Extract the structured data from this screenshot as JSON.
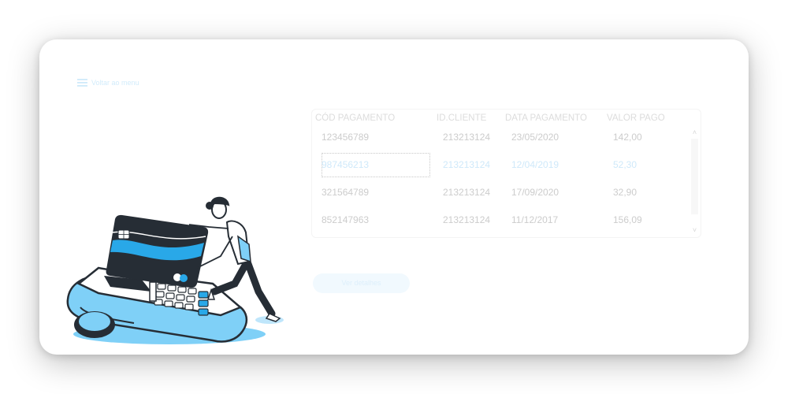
{
  "menu": {
    "label": "Voltar ao menu"
  },
  "table": {
    "headers": [
      "CÓD PAGAMENTO",
      "ID.CLIENTE",
      "DATA PAGAMENTO",
      "VALOR PAGO"
    ],
    "rows": [
      {
        "cod": "123456789",
        "cliente": "213213124",
        "data": "23/05/2020",
        "valor": "142,00"
      },
      {
        "cod": "987456213",
        "cliente": "213213124",
        "data": "12/04/2019",
        "valor": "52,30"
      },
      {
        "cod": "321564789",
        "cliente": "213213124",
        "data": "17/09/2020",
        "valor": "32,90"
      },
      {
        "cod": "852147963",
        "cliente": "213213124",
        "data": "11/12/2017",
        "valor": "156,09"
      }
    ],
    "selected_row": 1
  },
  "action_button": {
    "label": "Ver detalhes"
  },
  "icons": {
    "menu": "hamburger-icon",
    "scroll_up": "chevron-up-icon",
    "scroll_down": "chevron-down-icon"
  },
  "colors": {
    "accent": "#29a8e8",
    "accent_light": "#7fd0f7",
    "dark": "#262d35"
  }
}
